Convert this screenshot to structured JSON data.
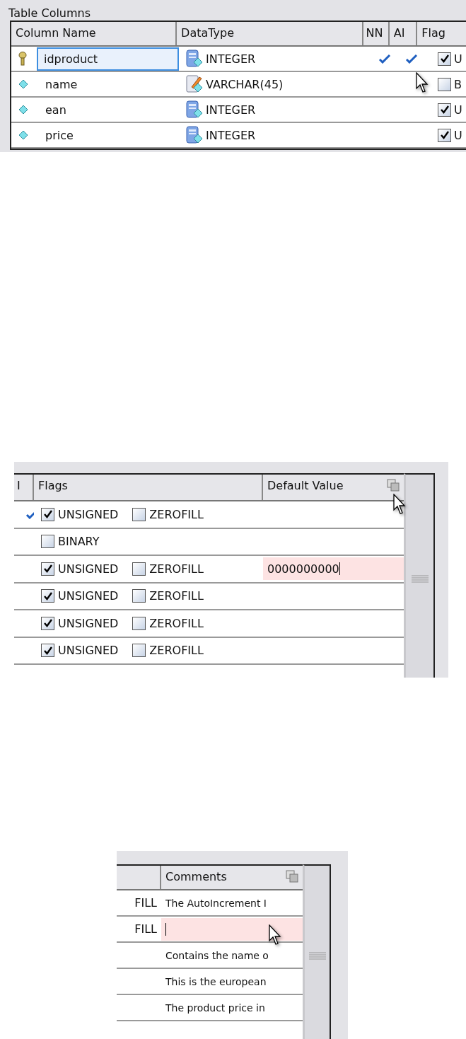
{
  "top_view": {
    "title": "Table Columns",
    "columns": [
      "Column Name",
      "DataType",
      "NN",
      "AI",
      "Flag"
    ],
    "rows": [
      {
        "kind": "key",
        "name": "idproduct",
        "editing": true,
        "datatype": {
          "kind": "number",
          "text": "INTEGER"
        },
        "nn": true,
        "ai": true,
        "flag": {
          "label": "U",
          "checked": true
        }
      },
      {
        "kind": "column",
        "name": "name",
        "editing": false,
        "datatype": {
          "kind": "text",
          "text": "VARCHAR(45)"
        },
        "nn": false,
        "ai": false,
        "flag": {
          "label": "B",
          "checked": false
        }
      },
      {
        "kind": "column",
        "name": "ean",
        "editing": false,
        "datatype": {
          "kind": "number",
          "text": "INTEGER"
        },
        "nn": false,
        "ai": false,
        "flag": {
          "label": "U",
          "checked": true
        }
      },
      {
        "kind": "column",
        "name": "price",
        "editing": false,
        "datatype": {
          "kind": "number",
          "text": "INTEGER"
        },
        "nn": false,
        "ai": false,
        "flag": {
          "label": "U",
          "checked": true
        }
      }
    ]
  },
  "flags_view": {
    "columns": [
      "I",
      "Flags",
      "Default Value"
    ],
    "rows": [
      {
        "ai": true,
        "flags": [
          {
            "label": "UNSIGNED",
            "checked": true
          },
          {
            "label": "ZEROFILL",
            "checked": false
          }
        ],
        "editing": false
      },
      {
        "ai": false,
        "flags": [
          {
            "label": "BINARY",
            "checked": false
          }
        ],
        "editing": false
      },
      {
        "ai": false,
        "flags": [
          {
            "label": "UNSIGNED",
            "checked": true
          },
          {
            "label": "ZEROFILL",
            "checked": false
          }
        ],
        "default": "0000000000",
        "editing": true
      },
      {
        "ai": false,
        "flags": [
          {
            "label": "UNSIGNED",
            "checked": true
          },
          {
            "label": "ZEROFILL",
            "checked": false
          }
        ],
        "editing": false
      },
      {
        "ai": false,
        "flags": [
          {
            "label": "UNSIGNED",
            "checked": true
          },
          {
            "label": "ZEROFILL",
            "checked": false
          }
        ],
        "editing": false
      },
      {
        "ai": false,
        "flags": [
          {
            "label": "UNSIGNED",
            "checked": true
          },
          {
            "label": "ZEROFILL",
            "checked": false
          }
        ],
        "editing": false
      }
    ]
  },
  "comments_view": {
    "columns": [
      "Comments"
    ],
    "rows": [
      {
        "flag": "FILL",
        "comment": "The AutoIncrement I",
        "editing": false
      },
      {
        "flag": "FILL",
        "editing": true
      },
      {
        "comment": "Contains the name o",
        "editing": false
      },
      {
        "comment": "This is the european",
        "editing": false
      },
      {
        "comment": "The product price in",
        "editing": false
      }
    ]
  }
}
